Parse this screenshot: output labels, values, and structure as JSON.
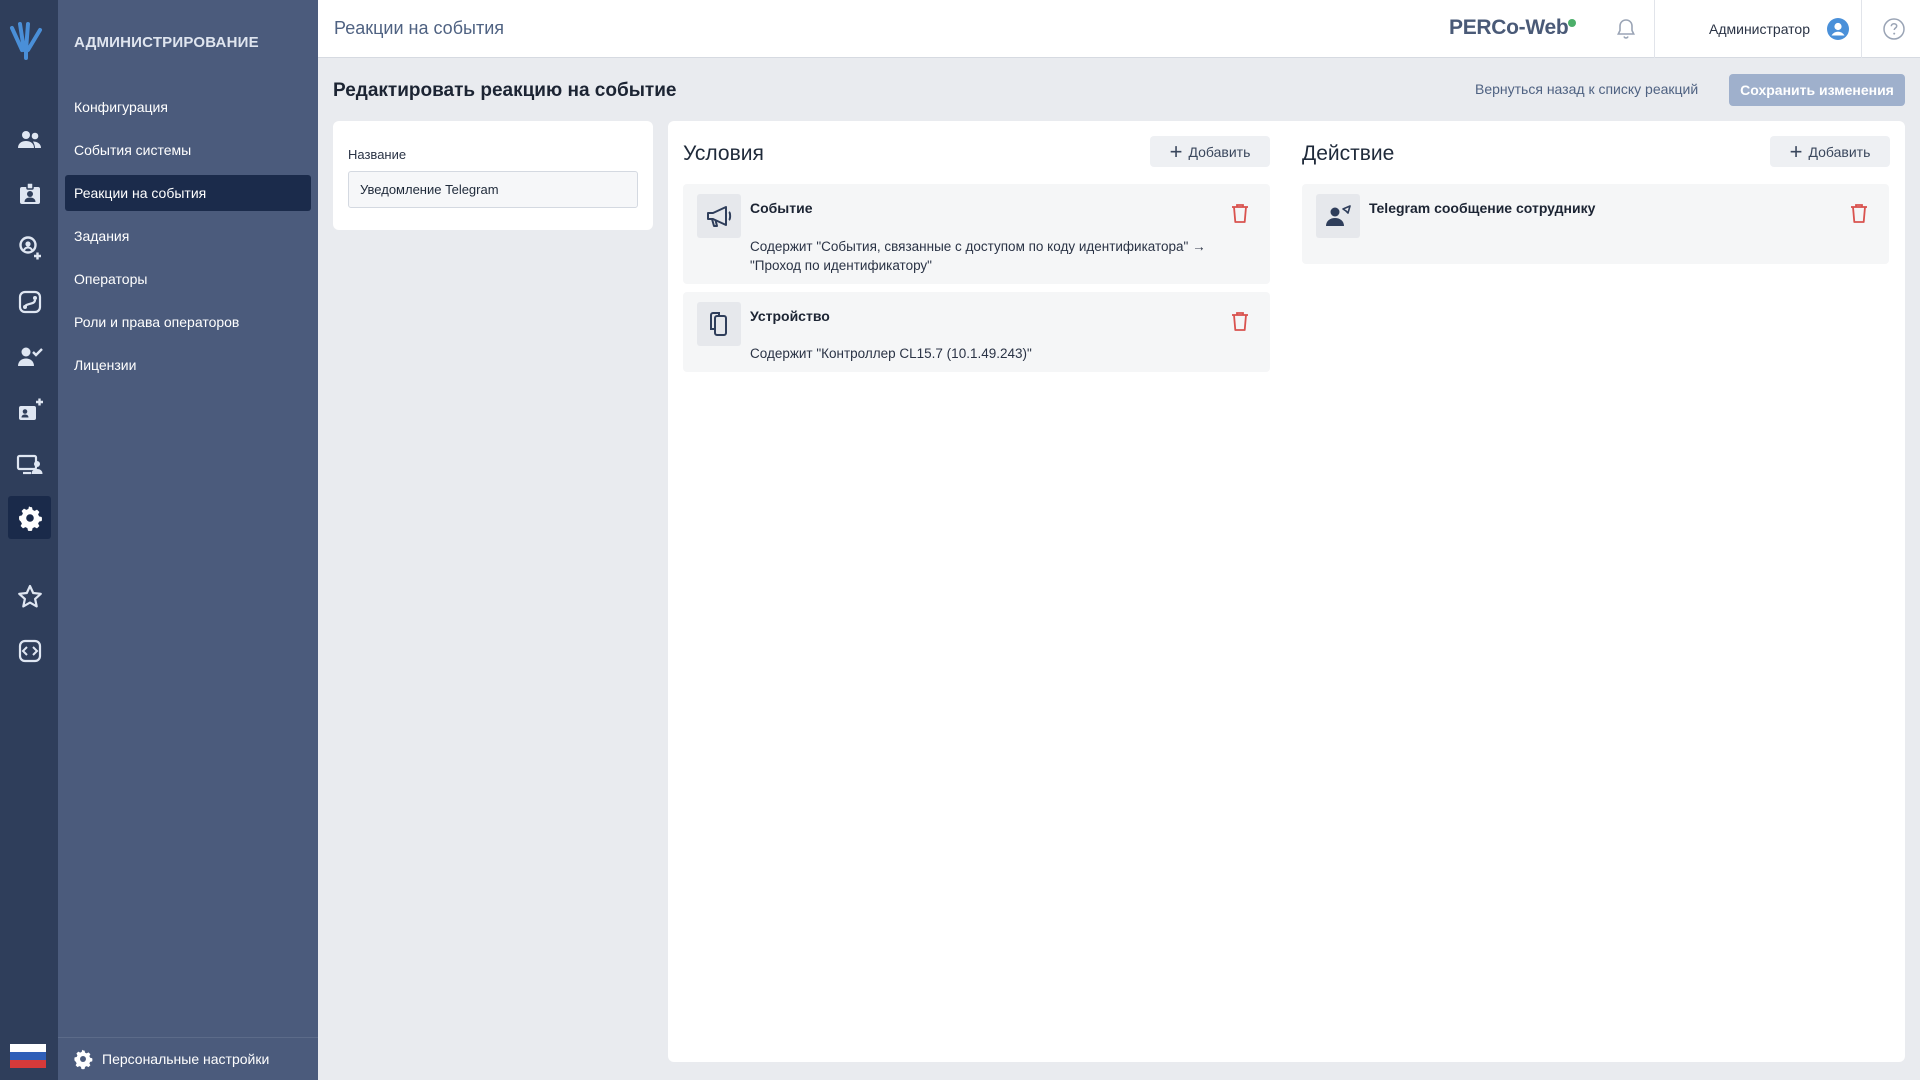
{
  "sidebar": {
    "heading": "АДМИНИСТРИРОВАНИЕ",
    "items": [
      {
        "label": "Конфигурация"
      },
      {
        "label": "События системы"
      },
      {
        "label": "Реакции на события"
      },
      {
        "label": "Задания"
      },
      {
        "label": "Операторы"
      },
      {
        "label": "Роли и права операторов"
      },
      {
        "label": "Лицензии"
      }
    ],
    "active_index": 2,
    "bottom_label": "Персональные настройки"
  },
  "rail": {
    "icons": [
      "people-icon",
      "id-badge-icon",
      "location-user-icon",
      "route-icon",
      "user-check-icon",
      "add-card-icon",
      "monitor-user-icon",
      "gear-icon",
      "star-icon",
      "code-icon"
    ],
    "active_icon": "gear-icon"
  },
  "header": {
    "title": "Реакции на события",
    "brand": "PERCo-Web",
    "user": "Администратор"
  },
  "page": {
    "title": "Редактировать реакцию на событие",
    "back_link": "Вернуться назад к списку реакций",
    "save_label": "Сохранить изменения"
  },
  "name_card": {
    "label": "Название",
    "value": "Уведомление Telegram"
  },
  "conditions": {
    "title": "Условия",
    "add_label": "Добавить",
    "items": [
      {
        "icon": "megaphone-icon",
        "title": "Событие",
        "desc_line1": "Содержит \"События, связанные с доступом по коду идентификатора\" →",
        "desc_line2": "\"Проход по идентификатору\""
      },
      {
        "icon": "device-icon",
        "title": "Устройство",
        "desc_line1": "Содержит \"Контроллер CL15.7 (10.1.49.243)\""
      }
    ]
  },
  "actions": {
    "title": "Действие",
    "add_label": "Добавить",
    "items": [
      {
        "icon": "user-message-icon",
        "title": "Telegram сообщение сотруднику"
      }
    ]
  },
  "colors": {
    "rail": "#2f3e5b",
    "sidebar": "#4b5b7c",
    "active": "#1b2b4b",
    "save_button": "#9fb0cc",
    "delete": "#d9534f"
  }
}
